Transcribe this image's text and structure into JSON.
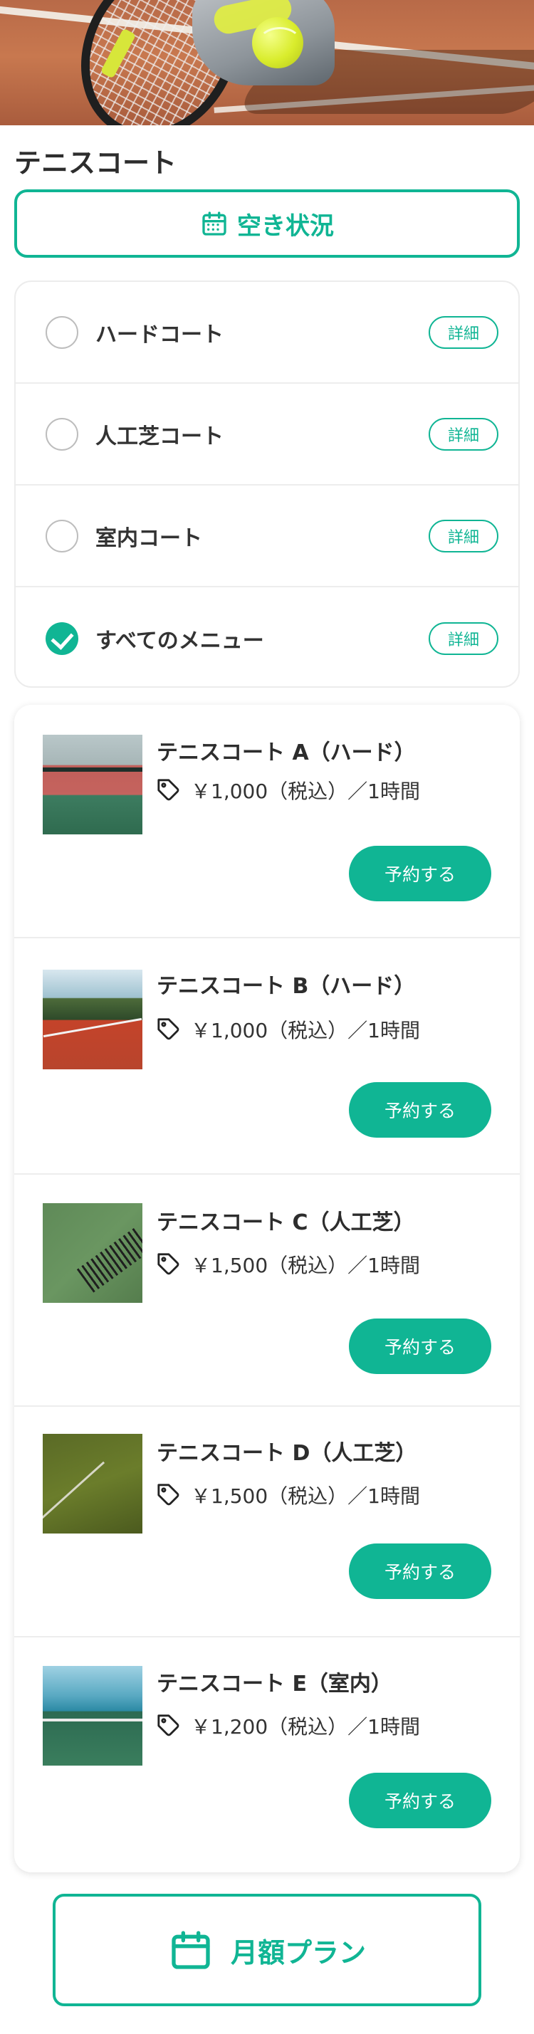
{
  "page": {
    "title": "テニスコート"
  },
  "availability": {
    "label": "空き状況",
    "icon": "calendar-icon"
  },
  "menu": {
    "detail_label": "詳細",
    "items": [
      {
        "label": "ハードコート",
        "selected": false
      },
      {
        "label": "人工芝コート",
        "selected": false
      },
      {
        "label": "室内コート",
        "selected": false
      },
      {
        "label": "すべてのメニュー",
        "selected": true
      }
    ]
  },
  "courts": {
    "reserve_label": "予約する",
    "items": [
      {
        "name": "テニスコート A（ハード）",
        "price": "￥1,000（税込）／1時間"
      },
      {
        "name": "テニスコート B（ハード）",
        "price": "￥1,000（税込）／1時間"
      },
      {
        "name": "テニスコート C（人工芝）",
        "price": "￥1,500（税込）／1時間"
      },
      {
        "name": "テニスコート D（人工芝）",
        "price": "￥1,500（税込）／1時間"
      },
      {
        "name": "テニスコート E（室内）",
        "price": "￥1,200（税込）／1時間"
      }
    ]
  },
  "monthly_plan": {
    "label": "月額プラン",
    "icon": "calendar-icon"
  },
  "colors": {
    "accent": "#10b594",
    "text": "#2d2d2d",
    "border": "#ececec"
  }
}
